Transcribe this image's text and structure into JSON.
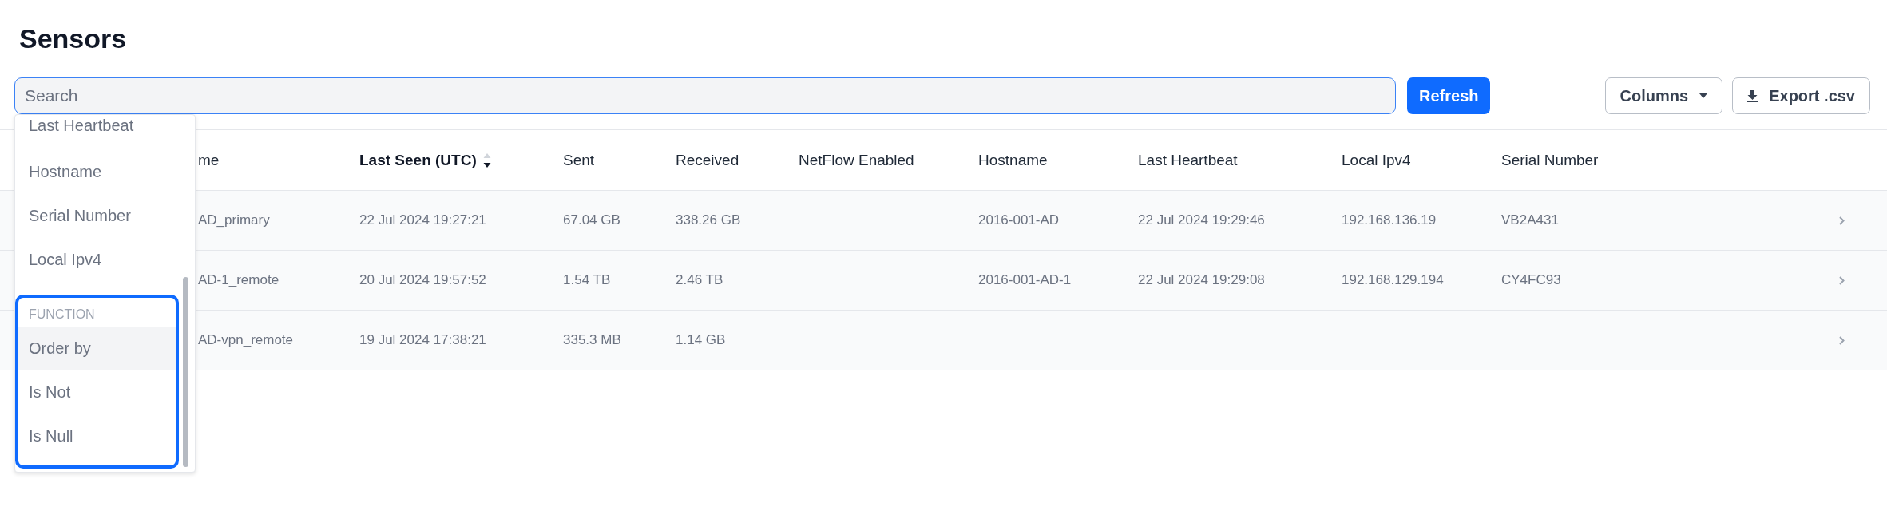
{
  "page": {
    "title": "Sensors"
  },
  "toolbar": {
    "search": {
      "placeholder": "Search",
      "focused": true
    },
    "refresh_button": "Refresh",
    "columns_button": "Columns",
    "export_button": "Export .csv"
  },
  "table": {
    "columns": [
      {
        "label": "me",
        "sorted": false
      },
      {
        "label": "Last Seen (UTC)",
        "sorted": true
      },
      {
        "label": "Sent",
        "sorted": false
      },
      {
        "label": "Received",
        "sorted": false
      },
      {
        "label": "NetFlow Enabled",
        "sorted": false
      },
      {
        "label": "Hostname",
        "sorted": false
      },
      {
        "label": "Last Heartbeat",
        "sorted": false
      },
      {
        "label": "Local Ipv4",
        "sorted": false
      },
      {
        "label": "Serial Number",
        "sorted": false
      }
    ],
    "rows": [
      {
        "cells": [
          "AD_primary",
          "22 Jul 2024 19:27:21",
          "67.04 GB",
          "338.26 GB",
          null,
          "2016-001-AD",
          "22 Jul 2024 19:29:46",
          "192.168.136.19",
          "VB2A431"
        ]
      },
      {
        "cells": [
          "AD-1_remote",
          "20 Jul 2024 19:57:52",
          "1.54 TB",
          "2.46 TB",
          null,
          "2016-001-AD-1",
          "22 Jul 2024 19:29:08",
          "192.168.129.194",
          "CY4FC93"
        ]
      },
      {
        "cells": [
          "AD-vpn_remote",
          "19 Jul 2024 17:38:21",
          "335.3 MB",
          "1.14 GB",
          null,
          null,
          null,
          null,
          null
        ]
      }
    ]
  },
  "dropdown": {
    "items": [
      "Last Heartbeat",
      "Hostname",
      "Serial Number",
      "Local Ipv4"
    ],
    "groups": [
      {
        "heading": "FUNCTION",
        "focused": true,
        "items": [
          {
            "label": "Order by",
            "selected": true
          },
          {
            "label": "Is Not",
            "selected": false
          },
          {
            "label": "Is Null",
            "selected": false
          }
        ]
      }
    ]
  }
}
